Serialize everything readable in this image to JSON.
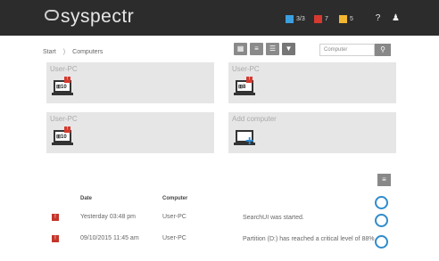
{
  "app": {
    "logo_text": "syspectr"
  },
  "topbar": {
    "stats": [
      {
        "label": "3/3",
        "color": "#3aa0e0"
      },
      {
        "label": "7",
        "color": "#d43a2f"
      },
      {
        "label": "5",
        "color": "#f2b630"
      }
    ],
    "icons": [
      "help-icon",
      "user-icon"
    ]
  },
  "breadcrumb": {
    "start": "Start",
    "separator": ")",
    "current": "Computers"
  },
  "toolbar": {
    "search_placeholder": "Computer"
  },
  "computers": [
    {
      "name": "User-PC",
      "label": "⊞10",
      "badge": "!"
    },
    {
      "name": "User-PC",
      "label": "⊞8",
      "badge": "!"
    },
    {
      "name": "User-PC",
      "label": "⊞10",
      "badge": "!"
    },
    {
      "name": "Add computer"
    }
  ],
  "events": {
    "headers": {
      "date": "Date",
      "computer": "Computer"
    },
    "rows": [
      {
        "date": "Yesterday 03:48 pm",
        "computer": "User-PC",
        "message": "SearchUI was started."
      },
      {
        "date": "09/10/2015 11:45 am",
        "computer": "User-PC",
        "message": "Partition (D:) has reached a critical level of 88%."
      }
    ]
  }
}
